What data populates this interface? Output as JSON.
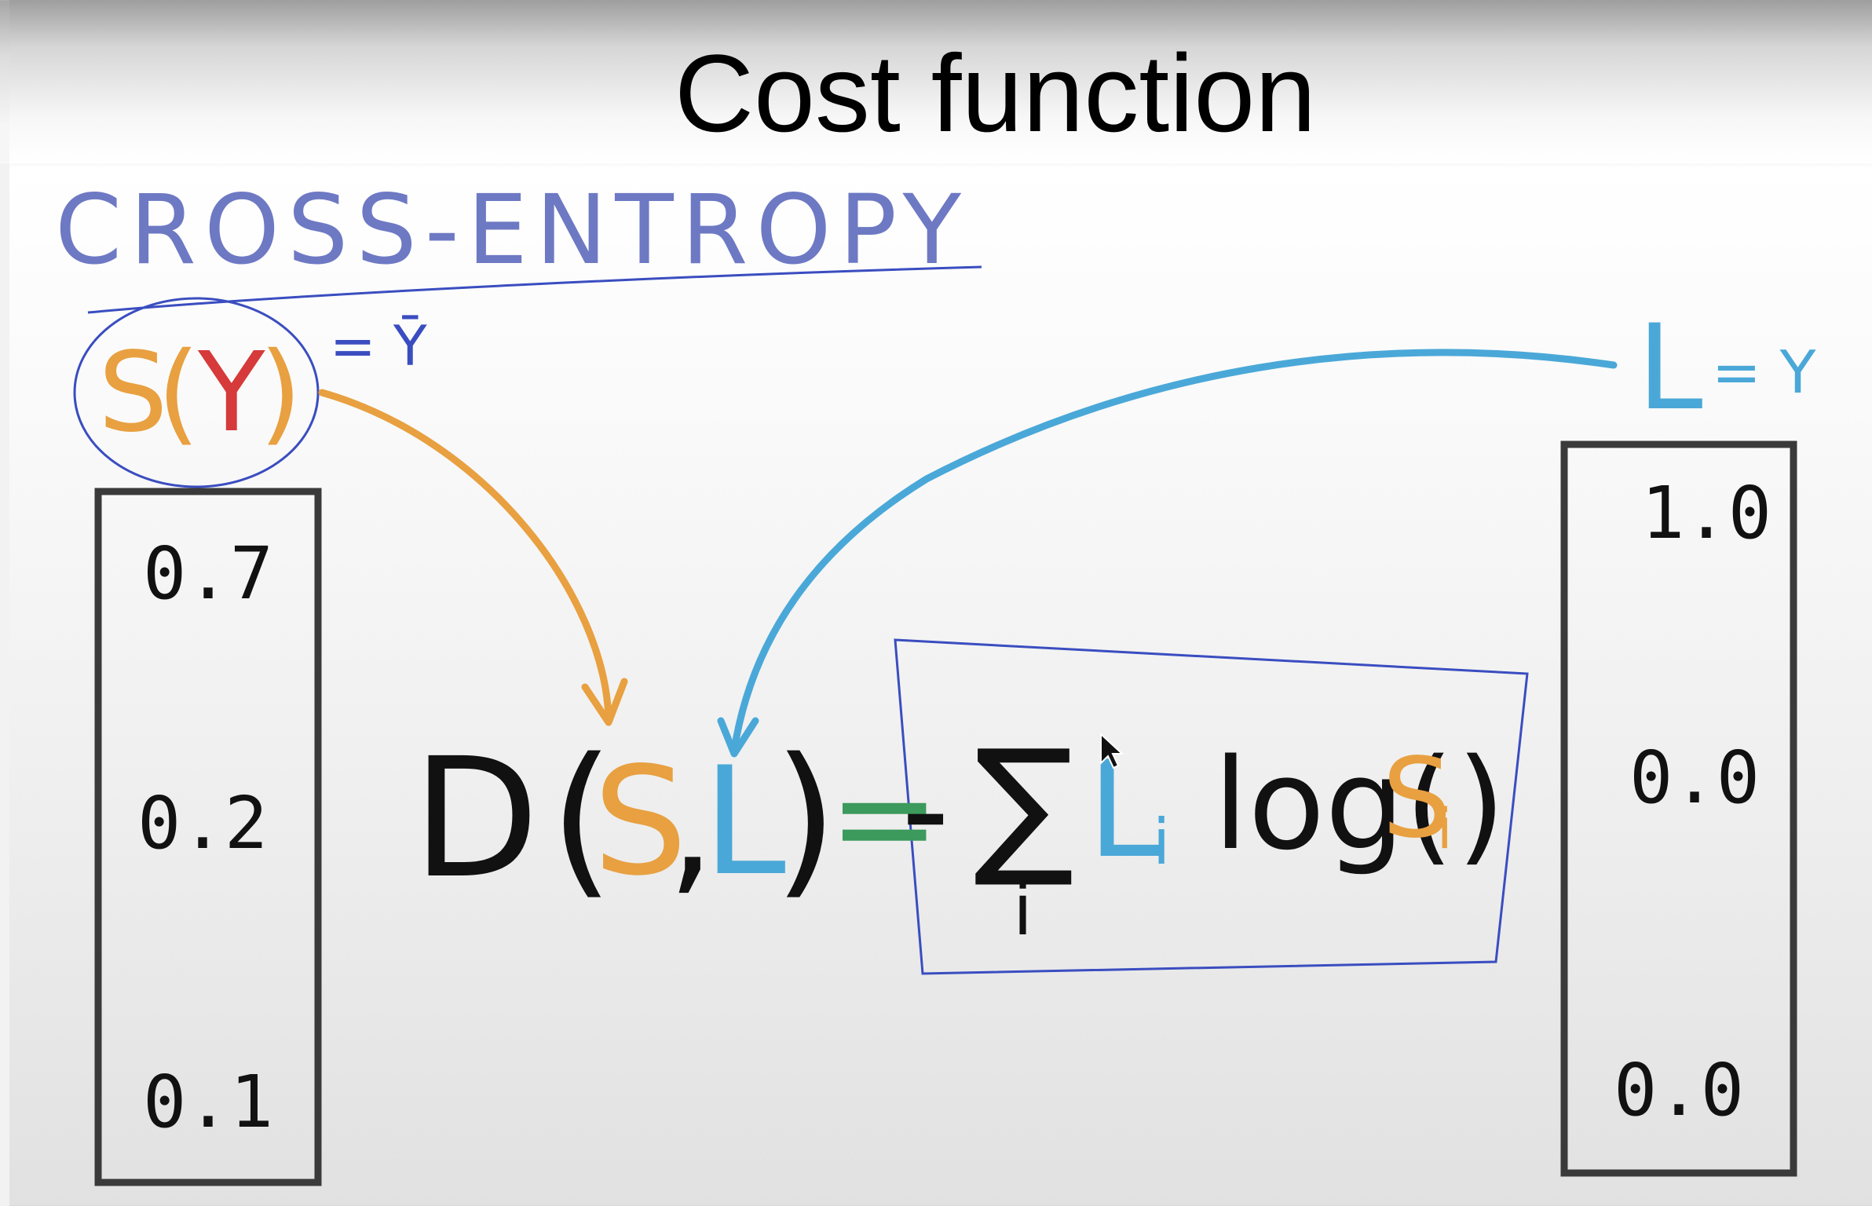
{
  "slide": {
    "title": "Cost function",
    "heading": "CROSS-ENTROPY"
  },
  "softmax": {
    "label_s": "S",
    "label_open": "(",
    "label_y": "Y",
    "label_close": ")",
    "annotation": "= Ȳ",
    "values": [
      "0.7",
      "0.2",
      "0.1"
    ]
  },
  "labels": {
    "label_l": "L",
    "annotation": "= Y",
    "values": [
      "1.0",
      "0.0",
      "0.0"
    ]
  },
  "formula": {
    "d": "D",
    "open": "(",
    "s": "S",
    "comma": ",",
    "l": "L",
    "close": ")",
    "equals": "=",
    "minus": "-",
    "sigma": "∑",
    "index": "i",
    "l_i": "L",
    "l_sub": "i",
    "log": "log(",
    "s_i": "S",
    "s_sub": "i",
    "log_close": ")"
  },
  "colors": {
    "heading": "#6e79c4",
    "underline": "#3a4dc0",
    "orange": "#e8a040",
    "red": "#d63a3a",
    "blue": "#4aa8d8",
    "green": "#3c9a5c",
    "ink": "#111111",
    "box_border": "#3a3a3a",
    "frame_blue": "#3a4dc0"
  }
}
